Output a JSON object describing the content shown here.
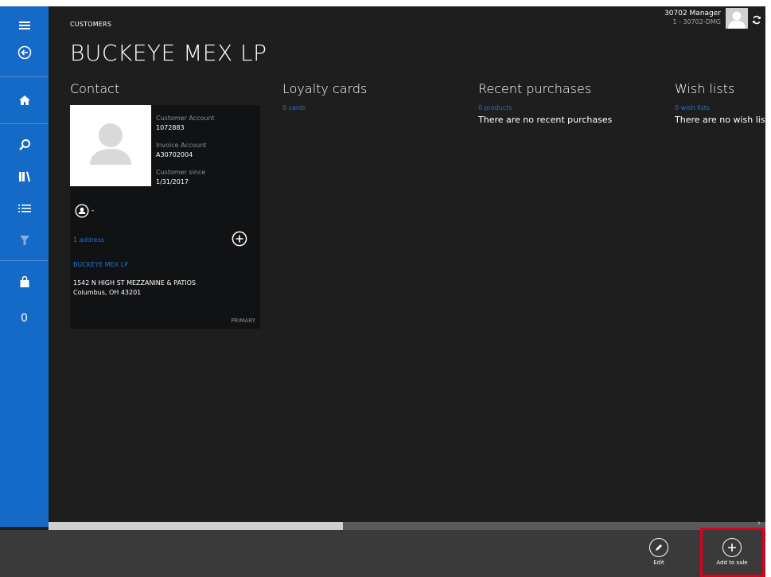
{
  "nav": {
    "items": [
      "menu-icon",
      "back-icon",
      "home-icon",
      "search-icon",
      "products-icon",
      "list-icon",
      "filter-icon",
      "cart-icon"
    ],
    "cart_count": "0"
  },
  "header": {
    "breadcrumb": "CUSTOMERS",
    "title": "BUCKEYE MEX LP",
    "user_name": "30702 Manager",
    "user_store": "1 - 30702-DMG"
  },
  "sections": {
    "contact": {
      "title": "Contact"
    },
    "loyalty": {
      "title": "Loyalty cards",
      "link": "0 cards"
    },
    "purchases": {
      "title": "Recent purchases",
      "link": "0 products",
      "note": "There are no recent purchases"
    },
    "wishlists": {
      "title": "Wish lists",
      "link": "0 wish lists",
      "note": "There are no wish list"
    }
  },
  "contact_card": {
    "customer_account_label": "Customer Account",
    "customer_account_value": "1072883",
    "invoice_account_label": "Invoice Account",
    "invoice_account_value": "A30702004",
    "customer_since_label": "Customer since",
    "customer_since_value": "1/31/2017",
    "contact_person": "-",
    "address_link": "1 address",
    "address_name": "BUCKEYE MEX LP",
    "address_line1": "1542 N HIGH ST MEZZANINE & PATIOS",
    "address_line2": "Columbus, OH 43201",
    "primary_label": "PRIMARY"
  },
  "appbar": {
    "edit_label": "Edit",
    "add_to_sale_label": "Add to sale"
  },
  "colors": {
    "nav": "#1569c7",
    "background": "#1e1e1e",
    "link": "#1e73d8",
    "highlight": "#e0001b"
  }
}
